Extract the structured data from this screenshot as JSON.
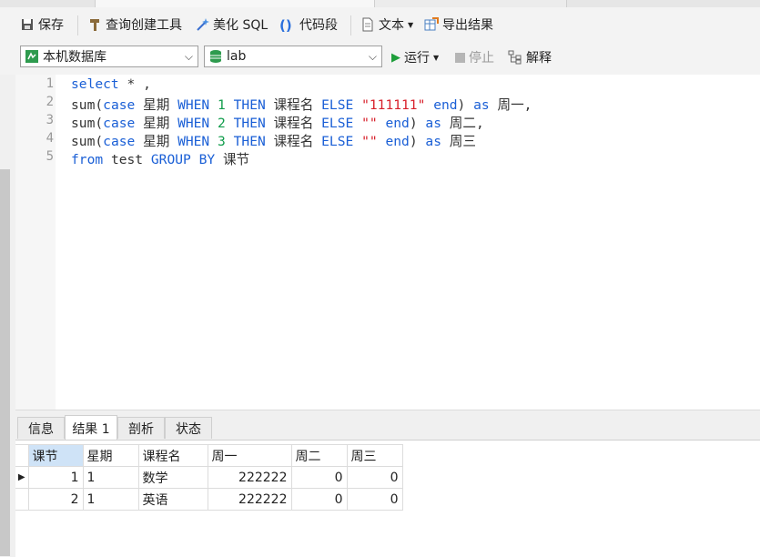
{
  "toolbar": {
    "save": "保存",
    "query_builder": "查询创建工具",
    "beautify": "美化 SQL",
    "snippet": "代码段",
    "text": "文本",
    "export": "导出结果"
  },
  "connection": {
    "server": "本机数据库",
    "database": "lab",
    "run": "运行",
    "stop": "停止",
    "explain": "解释"
  },
  "editor": {
    "line_numbers": [
      "1",
      "2",
      "3",
      "4",
      "5"
    ]
  },
  "result_tabs": [
    "信息",
    "结果 1",
    "剖析",
    "状态"
  ],
  "grid": {
    "columns": [
      "课节",
      "星期",
      "课程名",
      "周一",
      "周二",
      "周三"
    ],
    "rows": [
      [
        "1",
        "1",
        "数学",
        "222222",
        "0",
        "0"
      ],
      [
        "2",
        "1",
        "英语",
        "222222",
        "0",
        "0"
      ]
    ]
  },
  "colors": {
    "keyword": "#1a5fd6",
    "number": "#109c4b",
    "string": "#d81f2a",
    "run": "#1e9e3a"
  }
}
